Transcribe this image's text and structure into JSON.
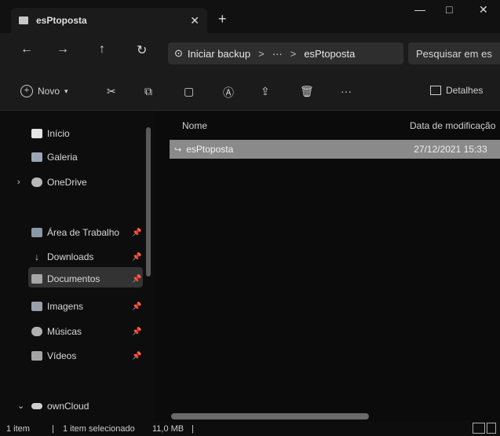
{
  "titlebar": {
    "tab_title": "esPtoposta",
    "close_glyph": "✕",
    "newtab_glyph": "+",
    "min_glyph": "—",
    "max_glyph": "□",
    "close_window_glyph": "✕"
  },
  "address": {
    "backup_label": "Iniciar backup",
    "sep": ">",
    "more": "···",
    "path": "esPtoposta",
    "search_placeholder": "Pesquisar em es"
  },
  "commands": {
    "new_label": "Novo",
    "more_label": "···",
    "details_label": "Detalhes"
  },
  "sidebar": {
    "items": [
      {
        "label": "Início"
      },
      {
        "label": "Galeria"
      },
      {
        "label": "OneDrive"
      },
      {
        "label": "Área de Trabalho"
      },
      {
        "label": "Downloads"
      },
      {
        "label": "Documentos"
      },
      {
        "label": "Imagens"
      },
      {
        "label": "Músicas"
      },
      {
        "label": "Vídeos"
      },
      {
        "label": "ownCloud"
      }
    ]
  },
  "columns": {
    "name": "Nome",
    "date": "Data de modificação"
  },
  "file": {
    "name": "esPtoposta",
    "date": "27/12/2021 15:33"
  },
  "status": {
    "count": "1 item",
    "selected": "1 item selecionado",
    "size": "11,0 MB",
    "divider": "|"
  }
}
